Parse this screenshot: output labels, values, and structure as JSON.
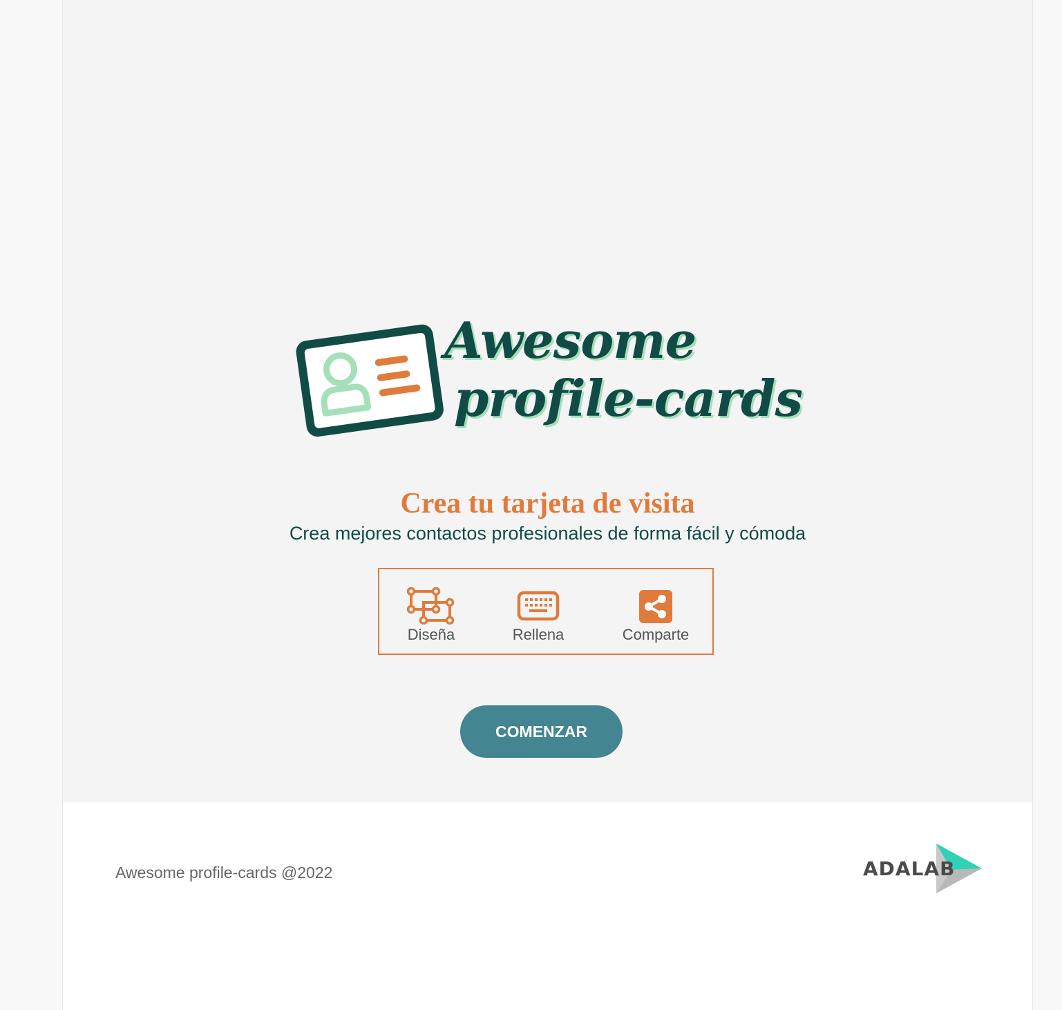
{
  "logo": {
    "line1": "Awesome",
    "line2": "profile-cards",
    "primary_color": "#114b45",
    "shadow_color": "#a6e0bb",
    "accent_color": "#e07b3c"
  },
  "hero": {
    "title": "Crea tu tarjeta de visita",
    "subtitle": "Crea mejores contactos profesionales de forma fácil y cómoda"
  },
  "steps": [
    {
      "label": "Diseña",
      "icon": "object-group-icon"
    },
    {
      "label": "Rellena",
      "icon": "keyboard-icon"
    },
    {
      "label": "Comparte",
      "icon": "share-icon"
    }
  ],
  "cta": {
    "label": "COMENZAR",
    "color": "#438590"
  },
  "footer": {
    "copyright": "Awesome profile-cards @2022",
    "brand": "ADALAB"
  }
}
